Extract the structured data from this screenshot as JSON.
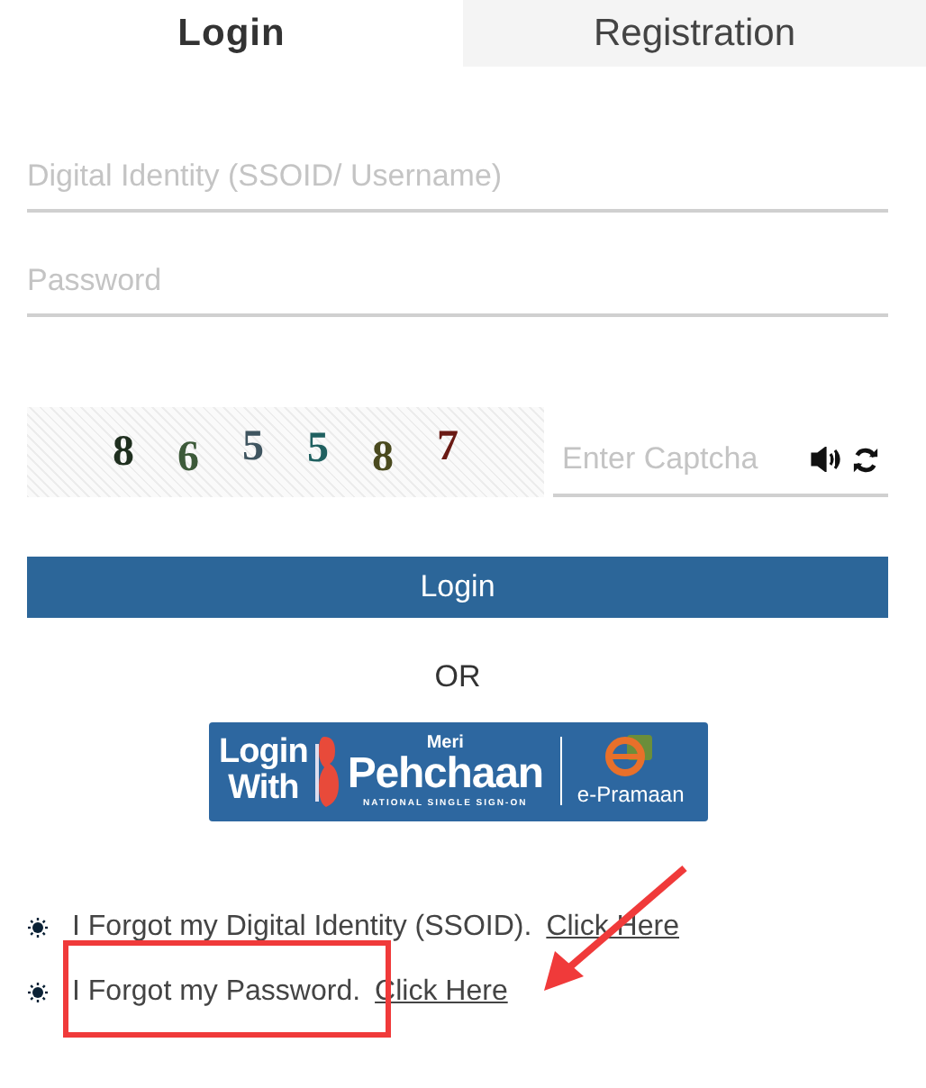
{
  "tabs": [
    {
      "label": "Login",
      "selected": true
    },
    {
      "label": "Registration",
      "selected": false
    }
  ],
  "username_field": {
    "placeholder": "Digital Identity (SSOID/ Username)"
  },
  "password_field": {
    "placeholder": "Password"
  },
  "captcha": {
    "characters": [
      {
        "char": "8",
        "color": "#1f2f1f"
      },
      {
        "char": "6",
        "color": "#3d5a3a"
      },
      {
        "char": "5",
        "color": "#3f5560"
      },
      {
        "char": "5",
        "color": "#1f6060"
      },
      {
        "char": "8",
        "color": "#4a4a1f"
      },
      {
        "char": "7",
        "color": "#6a1a14"
      }
    ],
    "placeholder": "Enter Captcha"
  },
  "login_button": "Login",
  "separator": "OR",
  "sso_logo": {
    "line_1": "Login",
    "line_2": "With",
    "brand_small": "Meri",
    "brand": "Pehchaan",
    "tagline": "NATIONAL SINGLE SIGN-ON",
    "partner": "e-Pramaan"
  },
  "help_links": [
    {
      "text": "I Forgot my Digital Identity (SSOID).",
      "link": "Click Here"
    },
    {
      "text": "I Forgot my Password.",
      "link": "Click Here",
      "highlighted": true
    }
  ]
}
